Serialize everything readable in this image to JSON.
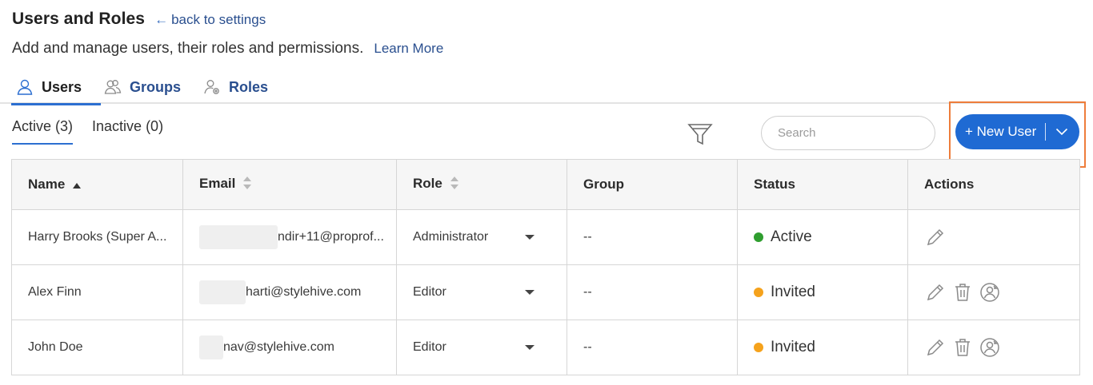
{
  "header": {
    "title": "Users and Roles",
    "back_label": "back to settings",
    "back_arrow": "←",
    "subtitle": "Add and manage users, their roles and permissions.",
    "learn_more": "Learn More"
  },
  "tabs": [
    {
      "label": "Users",
      "icon": "user-icon",
      "active": true
    },
    {
      "label": "Groups",
      "icon": "group-icon",
      "active": false
    },
    {
      "label": "Roles",
      "icon": "roles-icon",
      "active": false
    }
  ],
  "subtabs": [
    {
      "label": "Active (3)",
      "active": true
    },
    {
      "label": "Inactive (0)",
      "active": false
    }
  ],
  "toolbar": {
    "filter_icon": "filter-icon",
    "search_placeholder": "Search",
    "new_user_label": "+ New User"
  },
  "table": {
    "columns": [
      "Name",
      "Email",
      "Role",
      "Group",
      "Status",
      "Actions"
    ],
    "rows": [
      {
        "name": "Harry Brooks (Super A...",
        "email": "ndir+11@proprof...",
        "role": "Administrator",
        "group": "--",
        "status": "Active",
        "actions": [
          "edit"
        ]
      },
      {
        "name": "Alex Finn",
        "email": "harti@stylehive.com",
        "role": "Editor",
        "group": "--",
        "status": "Invited",
        "actions": [
          "edit",
          "delete",
          "resend"
        ]
      },
      {
        "name": "John Doe",
        "email": "nav@stylehive.com",
        "role": "Editor",
        "group": "--",
        "status": "Invited",
        "actions": [
          "edit",
          "delete",
          "resend"
        ]
      }
    ]
  },
  "colors": {
    "accent": "#1f6ad3",
    "link": "#2a4f8f",
    "highlight": "#ee7d3b",
    "status_active": "#2f9e2f",
    "status_invited": "#f5a21c"
  }
}
